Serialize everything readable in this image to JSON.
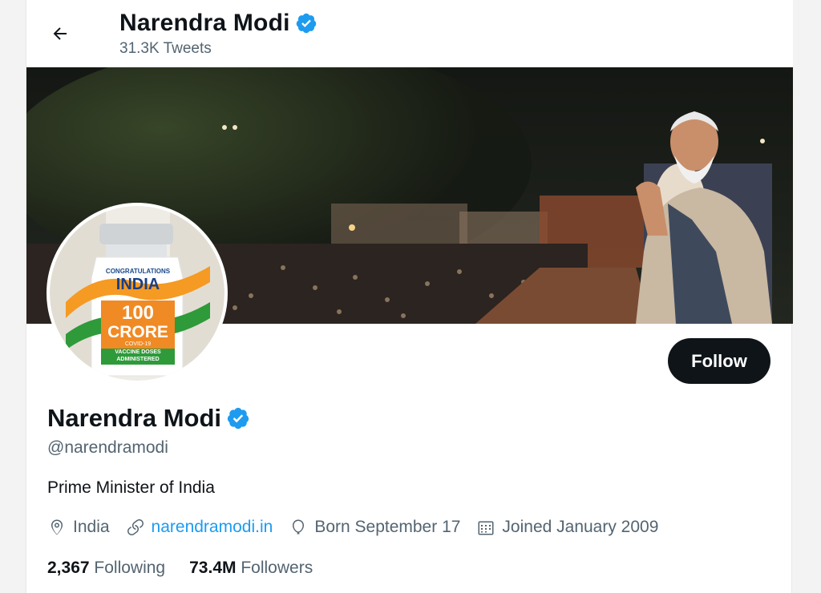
{
  "header": {
    "name": "Narendra Modi",
    "tweet_count": "31.3K Tweets"
  },
  "avatar": {
    "text_top": "CONGRATULATIONS",
    "text_country": "INDIA",
    "text_number": "100",
    "text_unit": "CRORE",
    "text_line1": "COVID-19",
    "text_line2": "VACCINE DOSES",
    "text_line3": "ADMINISTERED"
  },
  "actions": {
    "follow_label": "Follow"
  },
  "profile": {
    "name": "Narendra Modi",
    "handle": "@narendramodi",
    "bio": "Prime Minister of India",
    "location": "India",
    "website": "narendramodi.in",
    "birthday": "Born September 17",
    "joined": "Joined January 2009"
  },
  "stats": {
    "following_count": "2,367",
    "following_label": "Following",
    "followers_count": "73.4M",
    "followers_label": "Followers"
  },
  "colors": {
    "verified": "#1d9bf0",
    "link": "#1d9bf0",
    "follow_bg": "#0f1419",
    "secondary_text": "#536471"
  },
  "icons": [
    "back-arrow-icon",
    "verified-badge-icon",
    "location-icon",
    "link-icon",
    "balloon-icon",
    "calendar-icon"
  ]
}
